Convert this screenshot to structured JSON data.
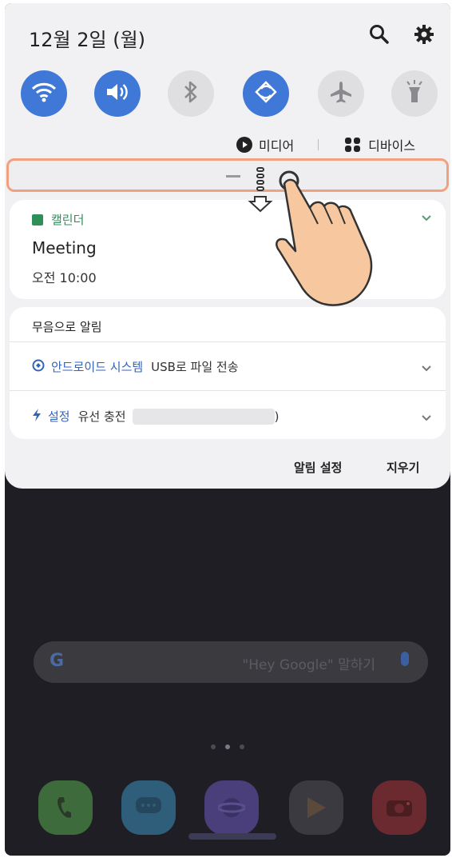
{
  "header": {
    "date": "12월 2일 (월)"
  },
  "quick_settings": [
    {
      "name": "wifi",
      "on": true
    },
    {
      "name": "sound",
      "on": true
    },
    {
      "name": "bluetooth",
      "on": false
    },
    {
      "name": "auto-rotate",
      "on": true
    },
    {
      "name": "airplane-mode",
      "on": false
    },
    {
      "name": "flashlight",
      "on": false
    }
  ],
  "media_row": {
    "media_label": "미디어",
    "separator": "|",
    "devices_label": "디바이스"
  },
  "calendar_card": {
    "app_name": "캘린더",
    "title": "Meeting",
    "time": "오전 10:00"
  },
  "silent_card": {
    "heading": "무음으로 알림",
    "rows": [
      {
        "app": "안드로이드 시스템",
        "text": "USB로 파일 전송"
      },
      {
        "app": "설정",
        "text": "유선 충전",
        "suffix": ")"
      }
    ]
  },
  "footer": {
    "notification_settings": "알림 설정",
    "clear": "지우기"
  },
  "home": {
    "search_hint": "\"Hey Google\" 말하기",
    "search_logo": "G"
  },
  "colors": {
    "accent": "#3f78d6",
    "calendar": "#2f8f5b",
    "highlight_border": "#f0a17f"
  }
}
